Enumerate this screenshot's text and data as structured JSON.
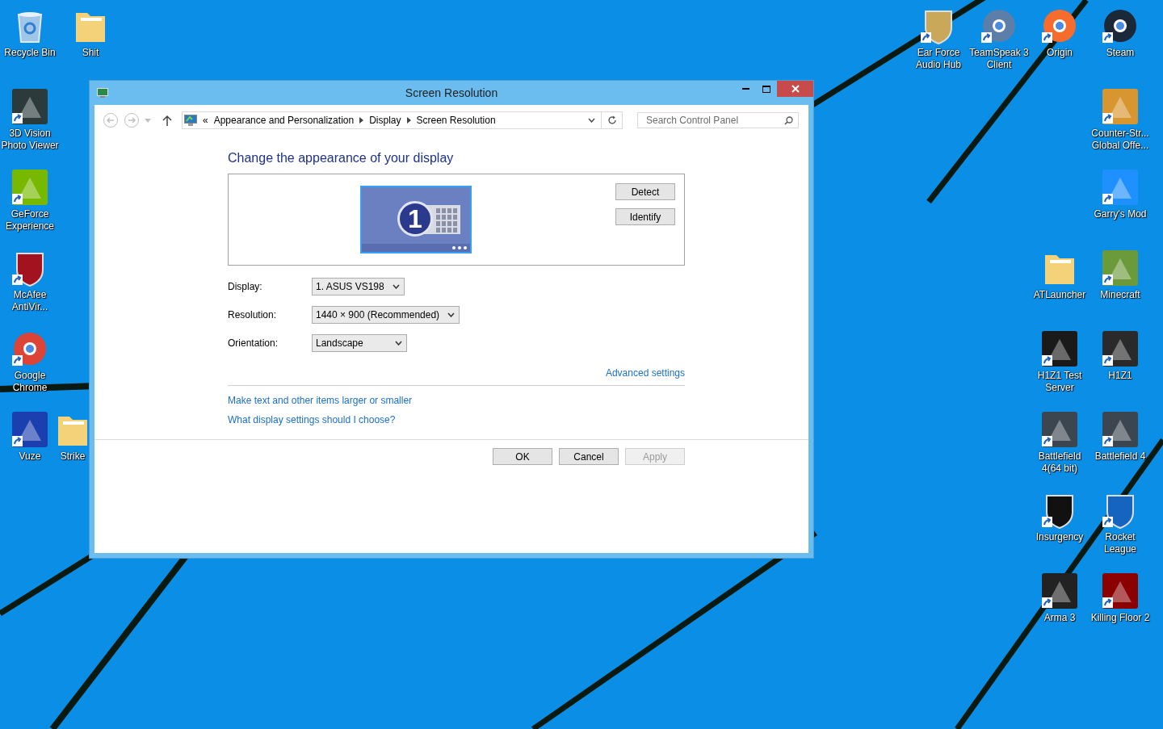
{
  "desktop_icons": [
    {
      "label": "Recycle Bin",
      "kind": "bin",
      "shortcut": false,
      "color": "#9fc6e8"
    },
    {
      "label": "Shit",
      "kind": "folder",
      "shortcut": false,
      "color": "#f3d27a"
    },
    {
      "label": "3D Vision Photo Viewer",
      "kind": "app",
      "shortcut": true,
      "color": "#2b3a3a"
    },
    {
      "label": "GeForce Experience",
      "kind": "app",
      "shortcut": true,
      "color": "#76b900"
    },
    {
      "label": "McAfee AntiVir...",
      "kind": "shield",
      "shortcut": true,
      "color": "#a3131f"
    },
    {
      "label": "Google Chrome",
      "kind": "orb",
      "shortcut": true,
      "color": "#db4437"
    },
    {
      "label": "Vuze",
      "kind": "app",
      "shortcut": true,
      "color": "#1c3fb0"
    },
    {
      "label": "Strike",
      "kind": "folder",
      "shortcut": false,
      "color": "#f3d27a"
    },
    {
      "label": "Ear Force Audio Hub",
      "kind": "shield",
      "shortcut": true,
      "color": "#c9a85a"
    },
    {
      "label": "TeamSpeak 3 Client",
      "kind": "orb",
      "shortcut": true,
      "color": "#5b7fa8"
    },
    {
      "label": "Origin",
      "kind": "orb",
      "shortcut": true,
      "color": "#f56c2d"
    },
    {
      "label": "Steam",
      "kind": "orb",
      "shortcut": true,
      "color": "#1b2838"
    },
    {
      "label": "Counter-Str... Global Offe...",
      "kind": "app",
      "shortcut": true,
      "color": "#d7962f"
    },
    {
      "label": "Garry's Mod",
      "kind": "app",
      "shortcut": true,
      "color": "#1e90ff"
    },
    {
      "label": "ATLauncher",
      "kind": "folder",
      "shortcut": false,
      "color": "#f3d27a"
    },
    {
      "label": "Minecraft",
      "kind": "app",
      "shortcut": true,
      "color": "#6a9a3a"
    },
    {
      "label": "H1Z1 Test Server",
      "kind": "app",
      "shortcut": true,
      "color": "#1a1a1a"
    },
    {
      "label": "H1Z1",
      "kind": "app",
      "shortcut": true,
      "color": "#2a2a2a"
    },
    {
      "label": "Battlefield 4(64 bit)",
      "kind": "app",
      "shortcut": true,
      "color": "#3c4650"
    },
    {
      "label": "Battlefield 4",
      "kind": "app",
      "shortcut": true,
      "color": "#3c4650"
    },
    {
      "label": "Insurgency",
      "kind": "shield",
      "shortcut": true,
      "color": "#111111"
    },
    {
      "label": "Rocket League",
      "kind": "shield",
      "shortcut": true,
      "color": "#1565c0"
    },
    {
      "label": "Arma 3",
      "kind": "app",
      "shortcut": true,
      "color": "#222222"
    },
    {
      "label": "Killing Floor 2",
      "kind": "app",
      "shortcut": true,
      "color": "#8b0000"
    }
  ],
  "window": {
    "title": "Screen Resolution",
    "address_bar": {
      "overflow": "«",
      "breadcrumbs": [
        "Appearance and Personalization",
        "Display",
        "Screen Resolution"
      ]
    },
    "search": {
      "placeholder": "Search Control Panel"
    },
    "heading": "Change the appearance of your display",
    "monitor": {
      "number": "1",
      "selected": true
    },
    "side_buttons": [
      "Detect",
      "Identify"
    ],
    "settings": [
      {
        "label": "Display:",
        "value": "1. ASUS VS198"
      },
      {
        "label": "Resolution:",
        "value": "1440 × 900 (Recommended)"
      },
      {
        "label": "Orientation:",
        "value": "Landscape"
      }
    ],
    "advanced_link": "Advanced settings",
    "help_links": [
      "Make text and other items larger or smaller",
      "What display settings should I choose?"
    ],
    "buttons": [
      {
        "label": "OK",
        "disabled": false
      },
      {
        "label": "Cancel",
        "disabled": false
      },
      {
        "label": "Apply",
        "disabled": true
      }
    ]
  }
}
